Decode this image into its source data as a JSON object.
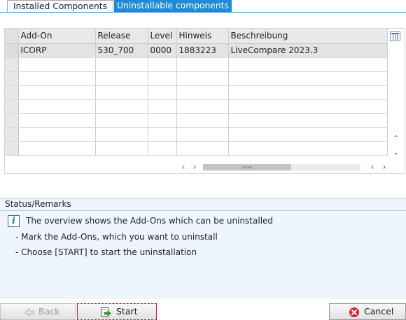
{
  "tabs": [
    {
      "label": "Installed Components",
      "active": false
    },
    {
      "label": "Uninstallable components",
      "active": true
    }
  ],
  "table": {
    "columns": [
      "Add-On",
      "Release",
      "Level",
      "Hinweis",
      "Beschreibung"
    ],
    "rows": [
      [
        "ICORP",
        "530_700",
        "0000",
        "1883223",
        "LiveCompare 2023.3"
      ]
    ],
    "empty_rows": 7
  },
  "icons": {
    "column_settings": "table-settings-icon",
    "info": "info-icon",
    "back": "back-arrow-icon",
    "start": "execute-icon",
    "cancel": "cancel-icon"
  },
  "status": {
    "title": "Status/Remarks",
    "info_glyph": "i",
    "lines": [
      "The overview shows the Add-Ons which can be uninstalled",
      "- Mark the Add-Ons, which you want to uninstall",
      "- Choose [START] to start the uninstallation"
    ]
  },
  "buttons": {
    "back": "Back",
    "start": "Start",
    "cancel": "Cancel"
  },
  "colors": {
    "accent": "#1f8ad6",
    "status_bg": "#eef5fc",
    "cancel_red": "#d9232d"
  }
}
